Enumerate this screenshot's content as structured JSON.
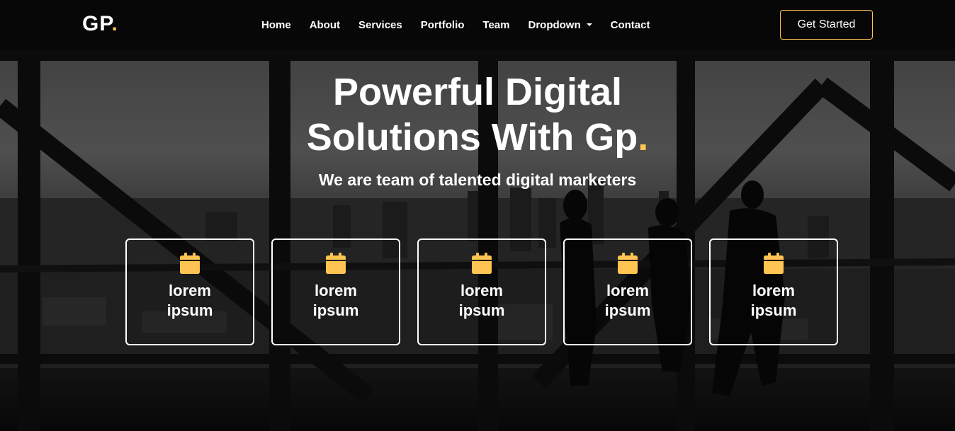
{
  "brand": {
    "logo_text": "GP",
    "logo_dot": ".",
    "accent_color": "#ffc451"
  },
  "nav": {
    "items": [
      {
        "label": "Home"
      },
      {
        "label": "About"
      },
      {
        "label": "Services"
      },
      {
        "label": "Portfolio"
      },
      {
        "label": "Team"
      },
      {
        "label": "Dropdown"
      },
      {
        "label": "Contact"
      }
    ],
    "dropdown_icon": "caret-down-icon"
  },
  "cta": {
    "label": "Get Started"
  },
  "hero": {
    "title_line1": "Powerful Digital",
    "title_line2": "Solutions With Gp",
    "title_dot": ".",
    "subtitle": "We are team of talented digital marketers"
  },
  "features": [
    {
      "title": "lorem ipsum",
      "icon": "calendar-icon"
    },
    {
      "title": "lorem ipsum",
      "icon": "calendar-icon"
    },
    {
      "title": "lorem ipsum",
      "icon": "calendar-icon"
    },
    {
      "title": "lorem ipsum",
      "icon": "calendar-icon"
    },
    {
      "title": "lorem ipsum",
      "icon": "calendar-icon"
    }
  ]
}
